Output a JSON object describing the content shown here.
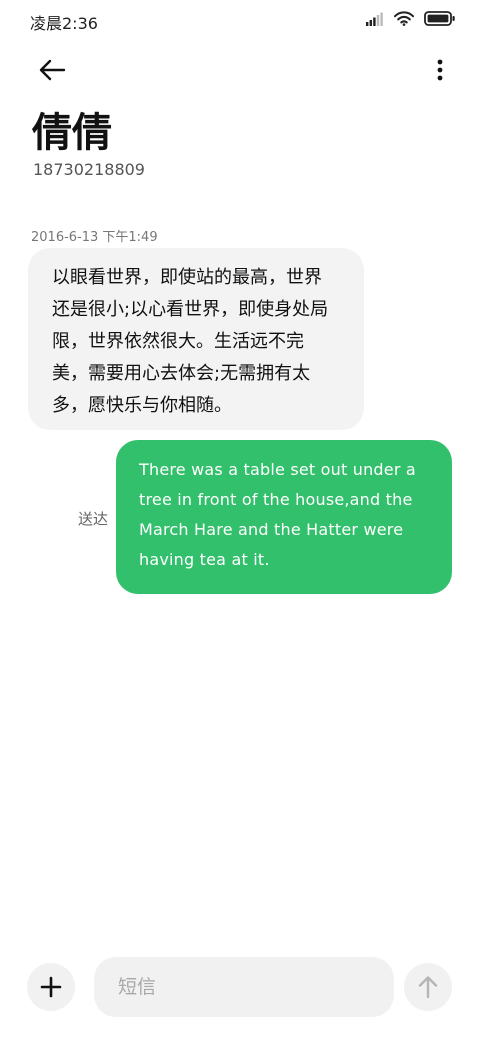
{
  "status_bar": {
    "time": "凌晨2:36",
    "icons": [
      "signal-icon",
      "wifi-icon",
      "battery-icon"
    ]
  },
  "header": {
    "back_icon": "arrow-left-icon",
    "more_icon": "more-vertical-icon",
    "contact_name": "倩倩",
    "contact_number": "18730218809"
  },
  "messages": {
    "timestamp": "2016-6-13 下午1:49",
    "incoming": {
      "text": "以眼看世界，即使站的最高，世界还是很小;以心看世界，即使身处局限，世界依然很大。生活远不完美，需要用心去体会;无需拥有太多，愿快乐与你相随。"
    },
    "outgoing": {
      "text": "There was a table set out under a tree in front of the house,and the March Hare and the Hatter were having tea at it.",
      "status": "送达"
    }
  },
  "composer": {
    "add_icon": "plus-icon",
    "placeholder": "短信",
    "value": "",
    "send_icon": "arrow-up-icon"
  },
  "colors": {
    "outgoing_bubble": "#33c06c",
    "incoming_bubble": "#f3f3f3",
    "control_bg": "#f1f1f1"
  }
}
